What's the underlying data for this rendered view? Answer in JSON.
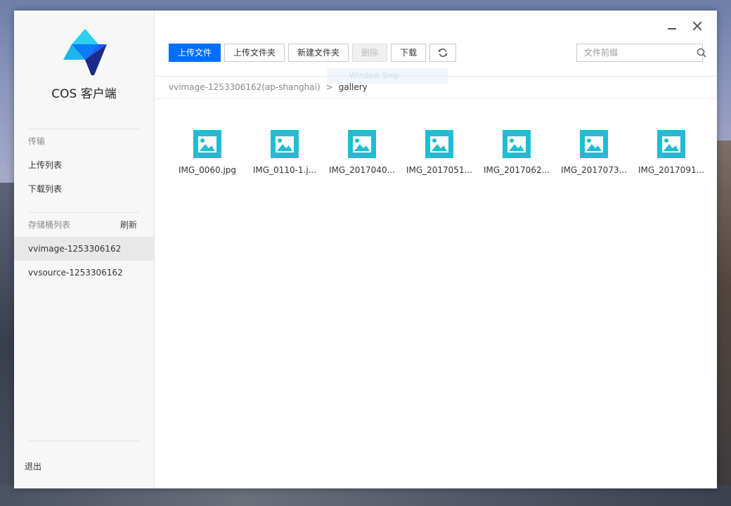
{
  "app": {
    "name": "COS 客户端"
  },
  "window": {
    "minimize_icon": "minimize-icon",
    "close_icon": "close-icon"
  },
  "sidebar": {
    "transfer_section": "传输",
    "transfer_items": [
      {
        "label": "上传列表"
      },
      {
        "label": "下载列表"
      }
    ],
    "bucket_section": "存储桶列表",
    "bucket_refresh": "刷新",
    "buckets": [
      {
        "label": "vvimage-1253306162",
        "active": true
      },
      {
        "label": "vvsource-1253306162",
        "active": false
      }
    ],
    "logout": "退出"
  },
  "toolbar": {
    "upload_file": "上传文件",
    "upload_folder": "上传文件夹",
    "new_folder": "新建文件夹",
    "delete": "删除",
    "download": "下载",
    "refresh_icon": "refresh-icon",
    "ghost_tip": "Window Snip"
  },
  "search": {
    "placeholder": "文件前缀",
    "value": "",
    "icon": "search-icon"
  },
  "breadcrumb": {
    "root": "vvimage-1253306162(ap-shanghai)",
    "separator": ">",
    "current": "gallery"
  },
  "files": [
    {
      "name": "IMG_0060.jpg",
      "icon": "image-icon"
    },
    {
      "name": "IMG_0110-1.j...",
      "icon": "image-icon"
    },
    {
      "name": "IMG_2017040...",
      "icon": "image-icon"
    },
    {
      "name": "IMG_2017051...",
      "icon": "image-icon"
    },
    {
      "name": "IMG_2017062...",
      "icon": "image-icon"
    },
    {
      "name": "IMG_2017073...",
      "icon": "image-icon"
    },
    {
      "name": "IMG_2017091...",
      "icon": "image-icon"
    }
  ],
  "colors": {
    "primary": "#006eff",
    "file_icon": "#1fbdd1",
    "logo_light": "#2dd0f0",
    "logo_mid": "#0a7cf5",
    "logo_dark": "#1a2b8c"
  }
}
